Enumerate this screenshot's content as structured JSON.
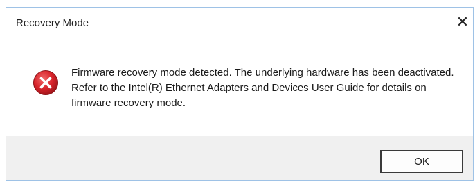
{
  "dialog": {
    "title": "Recovery Mode",
    "close_label": "✕",
    "icon": "error-icon",
    "message": "Firmware recovery mode detected. The underlying hardware has been deactivated. Refer to the Intel(R) Ethernet Adapters and Devices User Guide for details on firmware recovery mode.",
    "ok_label": "OK"
  },
  "colors": {
    "error_red": "#d8232a",
    "footer_bg": "#f0f0f0",
    "border": "#9ec2e6"
  }
}
